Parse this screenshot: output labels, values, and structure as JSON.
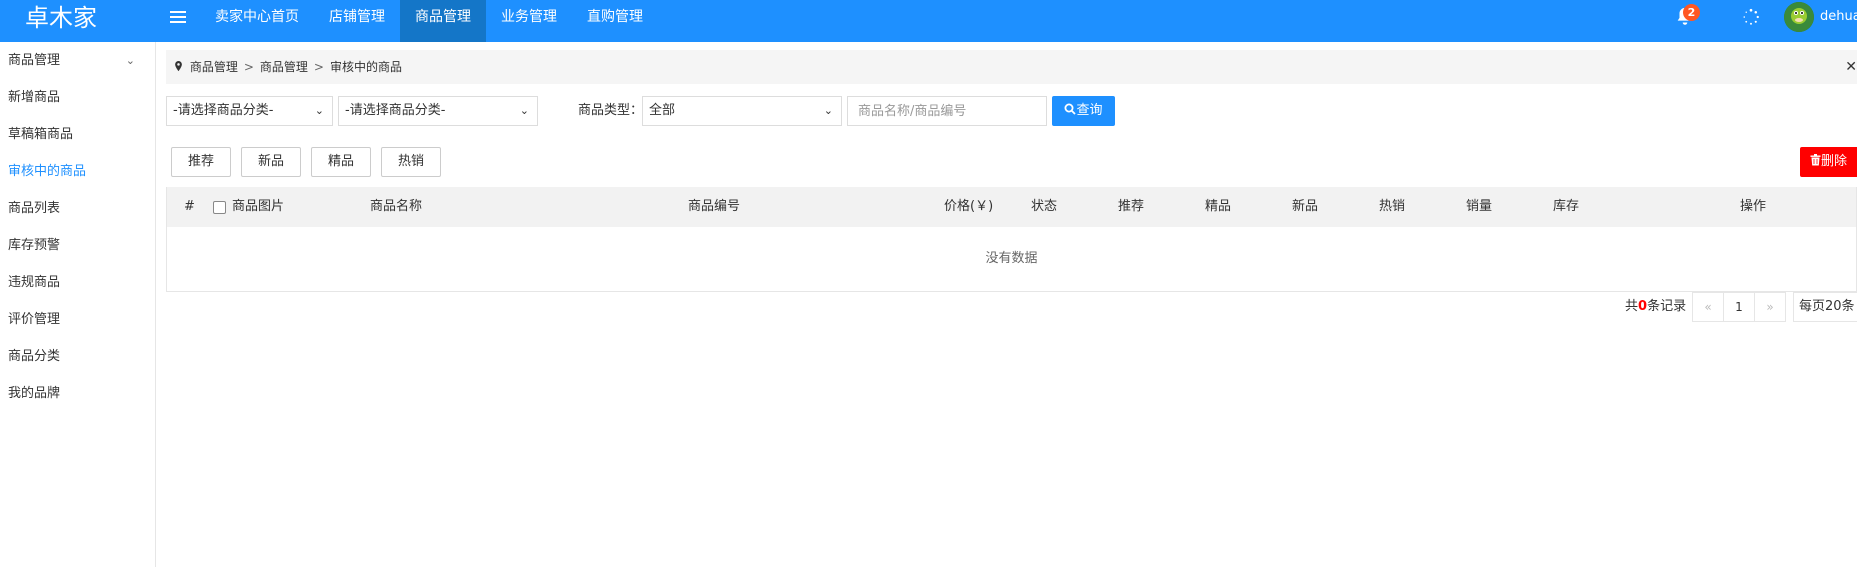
{
  "header": {
    "logo": "卓木家",
    "nav": [
      "卖家中心首页",
      "店铺管理",
      "商品管理",
      "业务管理",
      "直购管理"
    ],
    "active_nav": 2,
    "notification_count": "2",
    "username": "dehua"
  },
  "sidebar": {
    "items": [
      "商品管理",
      "新增商品",
      "草稿箱商品",
      "审核中的商品",
      "商品列表",
      "库存预警",
      "违规商品",
      "评价管理",
      "商品分类",
      "我的品牌"
    ],
    "active_index": 3
  },
  "breadcrumb": [
    "商品管理",
    "商品管理",
    "审核中的商品"
  ],
  "filters": {
    "category1": "-请选择商品分类-",
    "category2": "-请选择商品分类-",
    "type_label": "商品类型：",
    "type_value": "全部",
    "search_placeholder": "商品名称/商品编号",
    "query_label": "查询"
  },
  "actions": {
    "buttons": [
      "推荐",
      "新品",
      "精品",
      "热销"
    ],
    "delete_label": "删除"
  },
  "table": {
    "columns": [
      "#",
      "商品图片",
      "商品名称",
      "商品编号",
      "价格(￥)",
      "状态",
      "推荐",
      "精品",
      "新品",
      "热销",
      "销量",
      "库存",
      "操作"
    ],
    "empty_text": "没有数据"
  },
  "pagination": {
    "total_prefix": "共",
    "total_count": "0",
    "total_suffix": "条记录",
    "prev": "«",
    "current": "1",
    "next": "»",
    "page_size": "每页20条"
  },
  "colors": {
    "primary": "#1e90ff",
    "active_nav": "#1476c8",
    "danger": "#ff0000",
    "badge": "#ff5722"
  }
}
